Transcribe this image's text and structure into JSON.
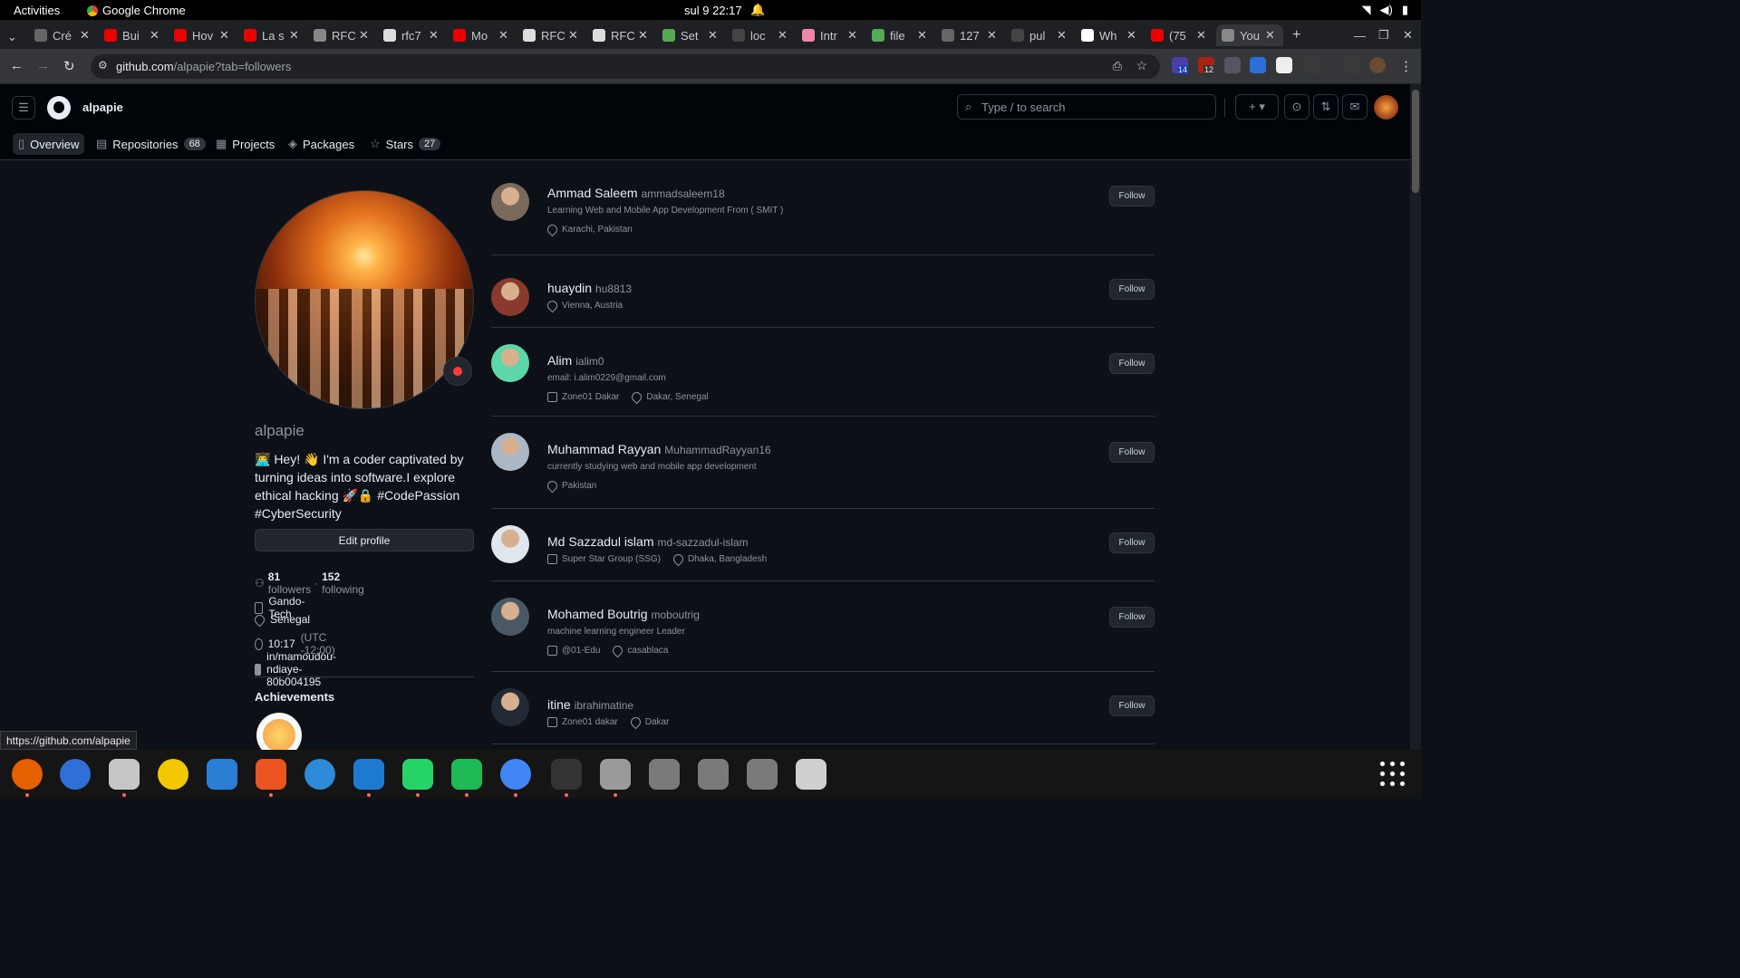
{
  "os": {
    "activities": "Activities",
    "app": "Google Chrome",
    "clock": "sul 9  22:17"
  },
  "browser": {
    "tabs": [
      {
        "label": "Cré",
        "color": "#666"
      },
      {
        "label": "Bui",
        "color": "#e00"
      },
      {
        "label": "Hov",
        "color": "#e00"
      },
      {
        "label": "La s",
        "color": "#e00"
      },
      {
        "label": "RFC",
        "color": "#888"
      },
      {
        "label": "rfc7",
        "color": "#ddd"
      },
      {
        "label": "Mo",
        "color": "#e00"
      },
      {
        "label": "RFC",
        "color": "#ddd"
      },
      {
        "label": "RFC",
        "color": "#ddd"
      },
      {
        "label": "Set",
        "color": "#5a5"
      },
      {
        "label": "loc",
        "color": "#444"
      },
      {
        "label": "Intr",
        "color": "#e8a"
      },
      {
        "label": "file",
        "color": "#5a5"
      },
      {
        "label": "127",
        "color": "#666"
      },
      {
        "label": "pul",
        "color": "#444"
      },
      {
        "label": "Wh",
        "color": "#fff"
      },
      {
        "label": "(75",
        "color": "#e00"
      },
      {
        "label": "You",
        "color": "#888"
      }
    ],
    "url_domain": "github.com",
    "url_path": "/alpapie?tab=followers",
    "ext_badges": [
      "14",
      "12"
    ],
    "status_url": "https://github.com/alpapie"
  },
  "gh": {
    "username_header": "alpapie",
    "search_placeholder": "Type / to search",
    "tabs": [
      {
        "label": "Overview",
        "count": ""
      },
      {
        "label": "Repositories",
        "count": "68"
      },
      {
        "label": "Projects",
        "count": ""
      },
      {
        "label": "Packages",
        "count": ""
      },
      {
        "label": "Stars",
        "count": "27"
      }
    ]
  },
  "profile": {
    "login": "alpapie",
    "bio": "👨‍💻 Hey! 👋 I'm a coder captivated by turning ideas into software.I explore ethical hacking 🚀🔒 #CodePassion #CyberSecurity",
    "edit": "Edit profile",
    "followers": "81",
    "followers_label": "followers",
    "dot": "·",
    "following": "152",
    "following_label": "following",
    "company": "Gando-Tech",
    "location": "Senegal",
    "time": "10:17",
    "tz": "(UTC -12:00)",
    "linkedin": "in/mamoudou-ndiaye-80b004195",
    "achievements": "Achievements"
  },
  "followers": [
    {
      "name": "Ammad Saleem",
      "login": "ammadsaleem18",
      "bio": "Learning Web and Mobile App Development From ( SMIT )",
      "company": "",
      "location": "Karachi, Pakistan",
      "btn": "Follow",
      "avatar": "#7a6a5c"
    },
    {
      "name": "huaydin",
      "login": "hu8813",
      "bio": "",
      "company": "",
      "location": "Vienna, Austria",
      "btn": "Follow",
      "avatar": "#8a3a2c"
    },
    {
      "name": "Alim",
      "login": "ialim0",
      "bio": "email: i.alim0229@gmail.com",
      "company": "Zone01 Dakar",
      "location": "Dakar, Senegal",
      "btn": "Follow",
      "avatar": "#5dd6a8"
    },
    {
      "name": "Muhammad Rayyan",
      "login": "MuhammadRayyan16",
      "bio": "currently studying web and mobile app development",
      "company": "",
      "location": "Pakistan",
      "btn": "Follow",
      "avatar": "#aab8c6"
    },
    {
      "name": "Md Sazzadul islam",
      "login": "md-sazzadul-islam",
      "bio": "",
      "company": "Super Star Group (SSG)",
      "location": "Dhaka, Bangladesh",
      "btn": "Follow",
      "avatar": "#dfe6ee"
    },
    {
      "name": "Mohamed Boutrig",
      "login": "moboutrig",
      "bio": "machine learning engineer Leader",
      "company": "@01-Edu",
      "location": "casablaca",
      "btn": "Follow",
      "avatar": "#4a5866"
    },
    {
      "name": "itine",
      "login": "ibrahimatine",
      "bio": "",
      "company": "Zone01 dakar",
      "location": "Dakar",
      "btn": "Follow",
      "avatar": "#222a36"
    }
  ]
}
